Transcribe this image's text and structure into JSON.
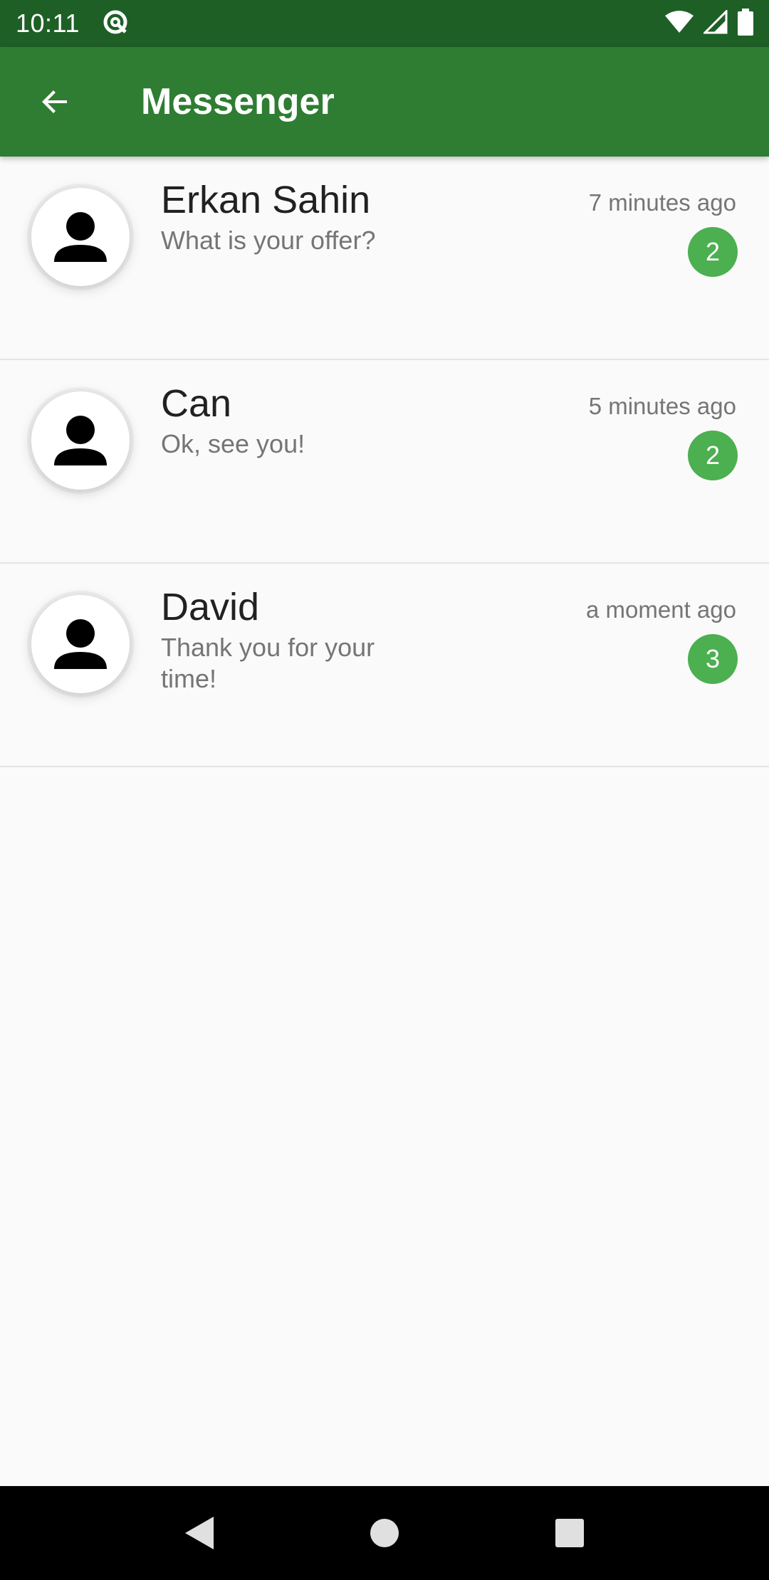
{
  "status_bar": {
    "time": "10:11",
    "icons": [
      "data-saver-icon",
      "wifi-icon",
      "signal-icon",
      "battery-icon"
    ]
  },
  "app_bar": {
    "title": "Messenger",
    "back_icon": "arrow-back-icon",
    "color": "#2e7d32"
  },
  "conversations": [
    {
      "name": "Erkan Sahin",
      "preview": "What is your offer?",
      "time": "7 minutes ago",
      "unread": "2"
    },
    {
      "name": "Can",
      "preview": "Ok, see you!",
      "time": "5 minutes ago",
      "unread": "2"
    },
    {
      "name": "David",
      "preview": "Thank you for your time!",
      "time": "a moment ago",
      "unread": "3"
    }
  ],
  "colors": {
    "badge": "#4caf50",
    "status_bar": "#1e5f26"
  },
  "nav_bar": {
    "icons": [
      "back-triangle-icon",
      "home-circle-icon",
      "recents-square-icon"
    ]
  }
}
